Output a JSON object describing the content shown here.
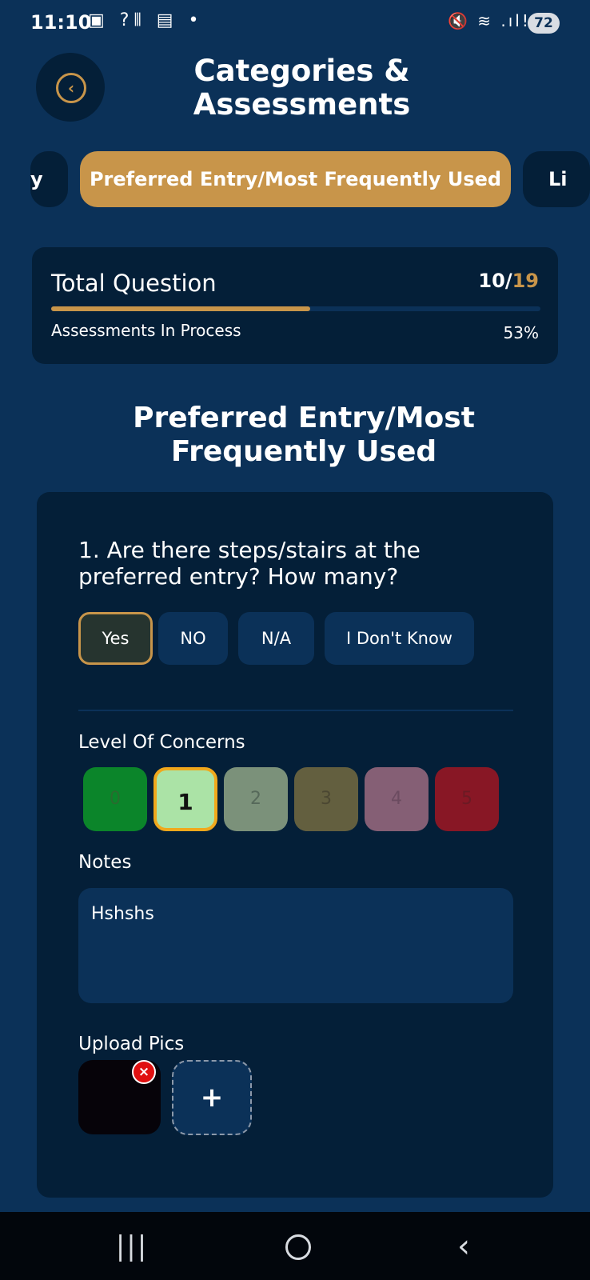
{
  "status_bar": {
    "time": "11:10",
    "left_icons": "▣ ?⫴ ▤ •",
    "right_icons": "🔇 ≋ .ıl!",
    "battery": "72"
  },
  "header": {
    "back_icon": "chevron-left-icon",
    "back_glyph": "‹",
    "title": "Categories & Assessments"
  },
  "tabs": {
    "prev_partial": "y",
    "active": "Preferred Entry/Most Frequently Used",
    "next_partial": "Li"
  },
  "progress": {
    "label": "Total Question",
    "answered": "10",
    "separator": "/",
    "total": "19",
    "subtitle": "Assessments In Process",
    "percent_text": "53%",
    "fill_fraction": 0.53
  },
  "section_title": "Preferred Entry/Most Frequently Used",
  "question": {
    "text": "1. Are there steps/stairs at the preferred entry? How many?",
    "answers": [
      "Yes",
      "NO",
      "N/A",
      "I Don't Know"
    ],
    "selected_answer": "Yes"
  },
  "concerns": {
    "label": "Level Of Concerns",
    "levels": [
      "0",
      "1",
      "2",
      "3",
      "4",
      "5"
    ],
    "selected": "1",
    "colors": [
      "#0b852a",
      "#abe3a6",
      "#7b917a",
      "#635f3f",
      "#855f75",
      "#881725"
    ]
  },
  "notes": {
    "label": "Notes",
    "value": "Hshshs"
  },
  "upload": {
    "label": "Upload Pics",
    "remove_glyph": "×",
    "add_glyph": "+"
  },
  "navbar": {
    "recents_glyph": "|||",
    "back_glyph": "‹"
  },
  "colors": {
    "background": "#0b3158",
    "card": "#041f38",
    "accent": "#c8954a"
  }
}
